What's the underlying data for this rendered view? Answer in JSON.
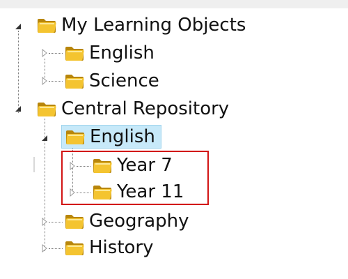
{
  "tree": {
    "roots": [
      {
        "label": "My Learning Objects",
        "expanded": true,
        "children": [
          {
            "label": "English",
            "expanded": false
          },
          {
            "label": "Science",
            "expanded": false
          }
        ]
      },
      {
        "label": "Central Repository",
        "expanded": true,
        "children": [
          {
            "label": "English",
            "expanded": true,
            "selected": true,
            "children": [
              {
                "label": "Year 7",
                "expanded": false
              },
              {
                "label": "Year 11",
                "expanded": false
              }
            ]
          },
          {
            "label": "Geography",
            "expanded": false
          },
          {
            "label": "History",
            "expanded": false
          }
        ]
      }
    ]
  },
  "colors": {
    "folder_fill": "#f4c430",
    "folder_dark": "#b8860b",
    "selection_bg": "#c7e9f9",
    "highlight_border": "#d21414"
  },
  "icons": {
    "folder": "folder-icon",
    "expanded": "expanded-triangle-icon",
    "collapsed": "collapsed-triangle-icon"
  }
}
